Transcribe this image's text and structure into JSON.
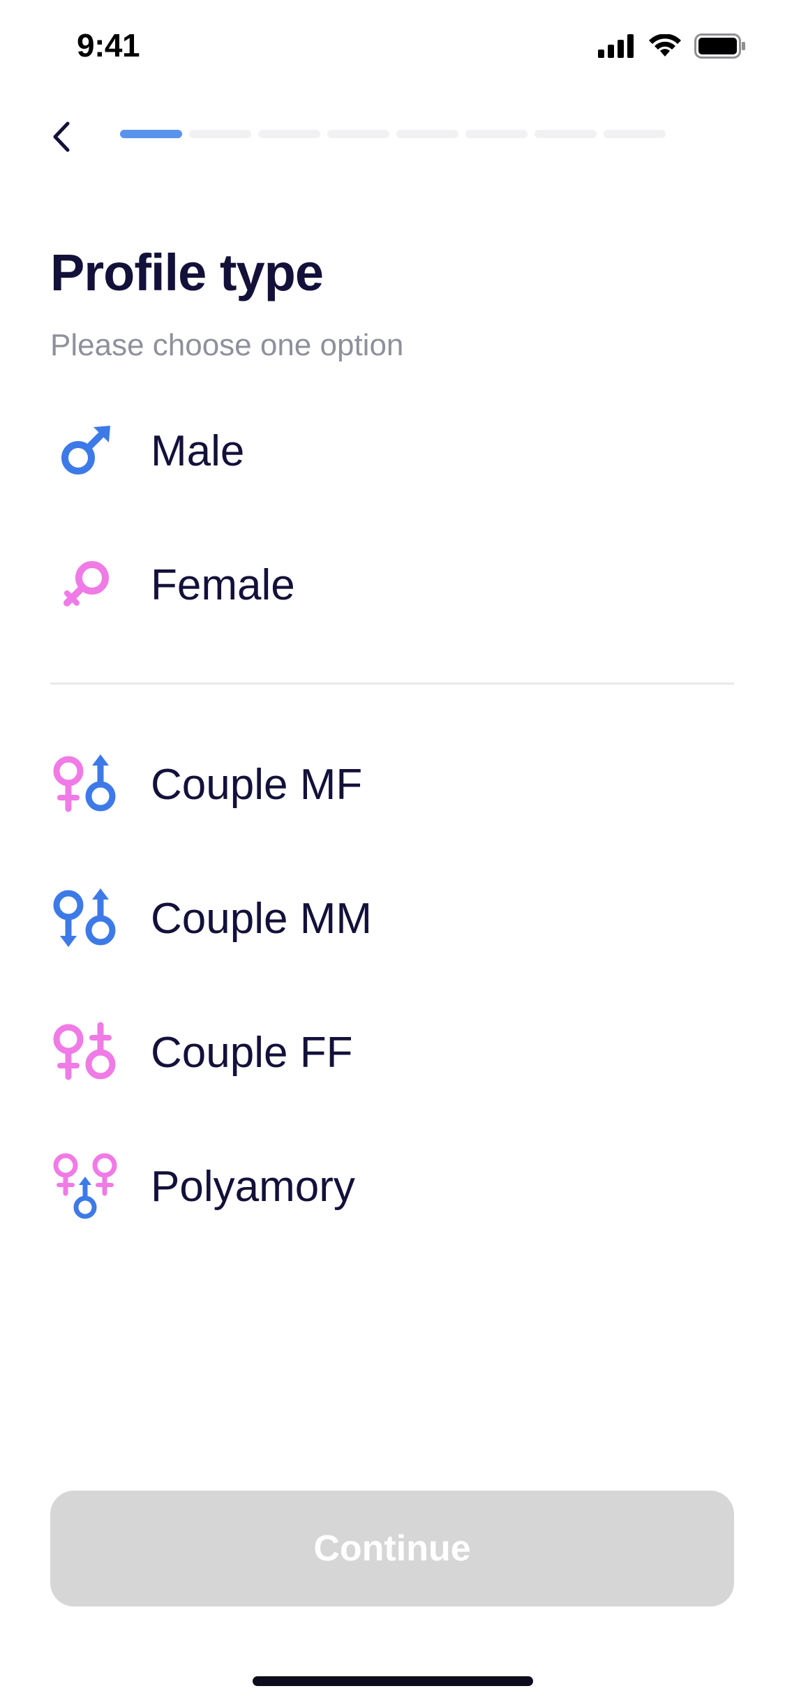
{
  "status_bar": {
    "time": "9:41",
    "icons": [
      "cellular-signal-icon",
      "wifi-icon",
      "battery-icon"
    ]
  },
  "header": {
    "back_icon": "chevron-left-icon",
    "progress": {
      "current_step": 1,
      "total_steps": 8
    }
  },
  "page": {
    "title": "Profile type",
    "subtitle": "Please choose one option"
  },
  "options": [
    {
      "label": "Male",
      "icon": "male-symbol-icon"
    },
    {
      "label": "Female",
      "icon": "female-symbol-icon"
    },
    {
      "label": "Couple MF",
      "icon": "couple-mf-icon"
    },
    {
      "label": "Couple MM",
      "icon": "couple-mm-icon"
    },
    {
      "label": "Couple FF",
      "icon": "couple-ff-icon"
    },
    {
      "label": "Polyamory",
      "icon": "polyamory-icon"
    }
  ],
  "footer": {
    "continue_label": "Continue",
    "continue_enabled": false
  },
  "colors": {
    "accent_blue": "#5a93ec",
    "male_blue": "#3d7ae8",
    "female_pink": "#f07ae6",
    "text_dark": "#13113a",
    "text_muted": "#8e909b",
    "button_disabled": "#d6d6d6"
  }
}
